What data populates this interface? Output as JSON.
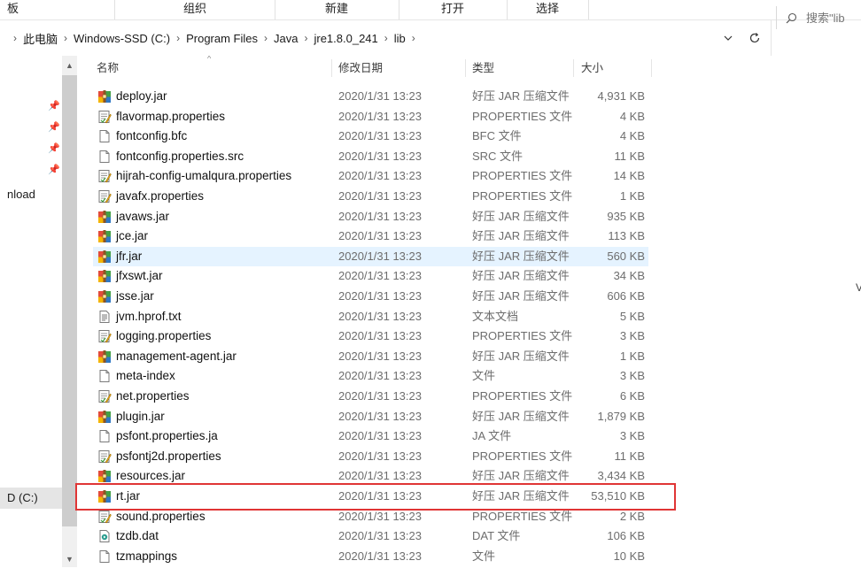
{
  "ribbon": {
    "groups": [
      "板",
      "组织",
      "新建",
      "打开",
      "选择"
    ]
  },
  "address": {
    "crumbs": [
      "此电脑",
      "Windows-SSD (C:)",
      "Program Files",
      "Java",
      "jre1.8.0_241",
      "lib"
    ],
    "search_placeholder": "搜索\"lib"
  },
  "nav": {
    "items": [
      {
        "label": "nload",
        "selected": false
      },
      {
        "label": "D (C:)",
        "selected": true
      }
    ]
  },
  "columns": {
    "name": "名称",
    "date": "修改日期",
    "type": "类型",
    "size": "大小"
  },
  "files": [
    {
      "name": "deploy.jar",
      "date": "2020/1/31 13:23",
      "type": "好压 JAR 压缩文件",
      "size": "4,931 KB",
      "icon": "jar-archive-icon"
    },
    {
      "name": "flavormap.properties",
      "date": "2020/1/31 13:23",
      "type": "PROPERTIES 文件",
      "size": "4 KB",
      "icon": "properties-file-icon"
    },
    {
      "name": "fontconfig.bfc",
      "date": "2020/1/31 13:23",
      "type": "BFC 文件",
      "size": "4 KB",
      "icon": "blank-file-icon"
    },
    {
      "name": "fontconfig.properties.src",
      "date": "2020/1/31 13:23",
      "type": "SRC 文件",
      "size": "11 KB",
      "icon": "blank-file-icon"
    },
    {
      "name": "hijrah-config-umalqura.properties",
      "date": "2020/1/31 13:23",
      "type": "PROPERTIES 文件",
      "size": "14 KB",
      "icon": "properties-file-icon"
    },
    {
      "name": "javafx.properties",
      "date": "2020/1/31 13:23",
      "type": "PROPERTIES 文件",
      "size": "1 KB",
      "icon": "properties-file-icon"
    },
    {
      "name": "javaws.jar",
      "date": "2020/1/31 13:23",
      "type": "好压 JAR 压缩文件",
      "size": "935 KB",
      "icon": "jar-archive-icon"
    },
    {
      "name": "jce.jar",
      "date": "2020/1/31 13:23",
      "type": "好压 JAR 压缩文件",
      "size": "113 KB",
      "icon": "jar-archive-icon"
    },
    {
      "name": "jfr.jar",
      "date": "2020/1/31 13:23",
      "type": "好压 JAR 压缩文件",
      "size": "560 KB",
      "icon": "jar-archive-icon",
      "hover": true
    },
    {
      "name": "jfxswt.jar",
      "date": "2020/1/31 13:23",
      "type": "好压 JAR 压缩文件",
      "size": "34 KB",
      "icon": "jar-archive-icon"
    },
    {
      "name": "jsse.jar",
      "date": "2020/1/31 13:23",
      "type": "好压 JAR 压缩文件",
      "size": "606 KB",
      "icon": "jar-archive-icon"
    },
    {
      "name": "jvm.hprof.txt",
      "date": "2020/1/31 13:23",
      "type": "文本文档",
      "size": "5 KB",
      "icon": "text-file-icon"
    },
    {
      "name": "logging.properties",
      "date": "2020/1/31 13:23",
      "type": "PROPERTIES 文件",
      "size": "3 KB",
      "icon": "properties-file-icon"
    },
    {
      "name": "management-agent.jar",
      "date": "2020/1/31 13:23",
      "type": "好压 JAR 压缩文件",
      "size": "1 KB",
      "icon": "jar-archive-icon"
    },
    {
      "name": "meta-index",
      "date": "2020/1/31 13:23",
      "type": "文件",
      "size": "3 KB",
      "icon": "blank-file-icon"
    },
    {
      "name": "net.properties",
      "date": "2020/1/31 13:23",
      "type": "PROPERTIES 文件",
      "size": "6 KB",
      "icon": "properties-file-icon"
    },
    {
      "name": "plugin.jar",
      "date": "2020/1/31 13:23",
      "type": "好压 JAR 压缩文件",
      "size": "1,879 KB",
      "icon": "jar-archive-icon"
    },
    {
      "name": "psfont.properties.ja",
      "date": "2020/1/31 13:23",
      "type": "JA 文件",
      "size": "3 KB",
      "icon": "blank-file-icon"
    },
    {
      "name": "psfontj2d.properties",
      "date": "2020/1/31 13:23",
      "type": "PROPERTIES 文件",
      "size": "11 KB",
      "icon": "properties-file-icon"
    },
    {
      "name": "resources.jar",
      "date": "2020/1/31 13:23",
      "type": "好压 JAR 压缩文件",
      "size": "3,434 KB",
      "icon": "jar-archive-icon"
    },
    {
      "name": "rt.jar",
      "date": "2020/1/31 13:23",
      "type": "好压 JAR 压缩文件",
      "size": "53,510 KB",
      "icon": "jar-archive-icon",
      "highlighted": true
    },
    {
      "name": "sound.properties",
      "date": "2020/1/31 13:23",
      "type": "PROPERTIES 文件",
      "size": "2 KB",
      "icon": "properties-file-icon"
    },
    {
      "name": "tzdb.dat",
      "date": "2020/1/31 13:23",
      "type": "DAT 文件",
      "size": "106 KB",
      "icon": "media-file-icon"
    },
    {
      "name": "tzmappings",
      "date": "2020/1/31 13:23",
      "type": "文件",
      "size": "10 KB",
      "icon": "blank-file-icon"
    }
  ],
  "colors": {
    "hover_row": "#e5f3ff",
    "highlight_border": "#e03535",
    "nav_selected": "#e5e5e5"
  },
  "right_edge_char": "V"
}
